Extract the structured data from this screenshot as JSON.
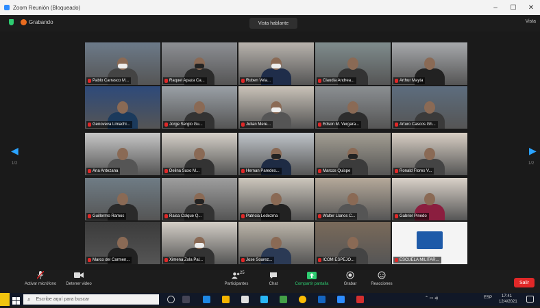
{
  "window": {
    "title": "Zoom Reunión (Bloqueado)"
  },
  "topbar": {
    "recording_label": "Grabando",
    "speaker_view_label": "Vista hablante",
    "view_label": "Vista"
  },
  "participants": [
    {
      "name": "Pablo Carrasco M..."
    },
    {
      "name": "Raquel Apaza Ca..."
    },
    {
      "name": "Ruben Vela..."
    },
    {
      "name": "Claudia Andrea..."
    },
    {
      "name": "Arthur Mayta"
    },
    {
      "name": "Genoveva Limachi..."
    },
    {
      "name": "Jorge Sergio Gu..."
    },
    {
      "name": "Julian Mere..."
    },
    {
      "name": "Edson M. Vergara..."
    },
    {
      "name": "Arturo Cascos Gh..."
    },
    {
      "name": "Ana Antezana"
    },
    {
      "name": "Delina Suxo M..."
    },
    {
      "name": "Hernan Paredes..."
    },
    {
      "name": "Marcos Quispe"
    },
    {
      "name": "Ronald Flores V..."
    },
    {
      "name": "Guillermo Ramos"
    },
    {
      "name": "Raisa Colque Q..."
    },
    {
      "name": "Patricia Ledezma"
    },
    {
      "name": "Walter Llanos C..."
    },
    {
      "name": "Gabriel Pinedo"
    },
    {
      "name": "Marco del Carmen..."
    },
    {
      "name": "Ximena Zola Pal..."
    },
    {
      "name": "Jose Soarez..."
    },
    {
      "name": "ICOM ESPEJO..."
    },
    {
      "name": "ESCUELA MILITAR..."
    }
  ],
  "nav": {
    "page_left": "1/2",
    "page_right": "1/2"
  },
  "toolbar": {
    "audio_label": "Activar micrófono",
    "video_label": "Detener video",
    "participants_label": "Participantes",
    "participants_count": "25",
    "chat_label": "Chat",
    "share_label": "Compartir pantalla",
    "record_label": "Grabar",
    "reactions_label": "Reacciones",
    "end_label": "Salir"
  },
  "taskbar": {
    "search_placeholder": "Escribe aquí para buscar",
    "time": "17:41",
    "date": "12/4/2021",
    "lang": "ESP"
  },
  "colors": {
    "zoom_blue": "#2d8cff",
    "mute_red": "#e02828",
    "share_green": "#2ecc71",
    "end_red": "#e02828"
  }
}
